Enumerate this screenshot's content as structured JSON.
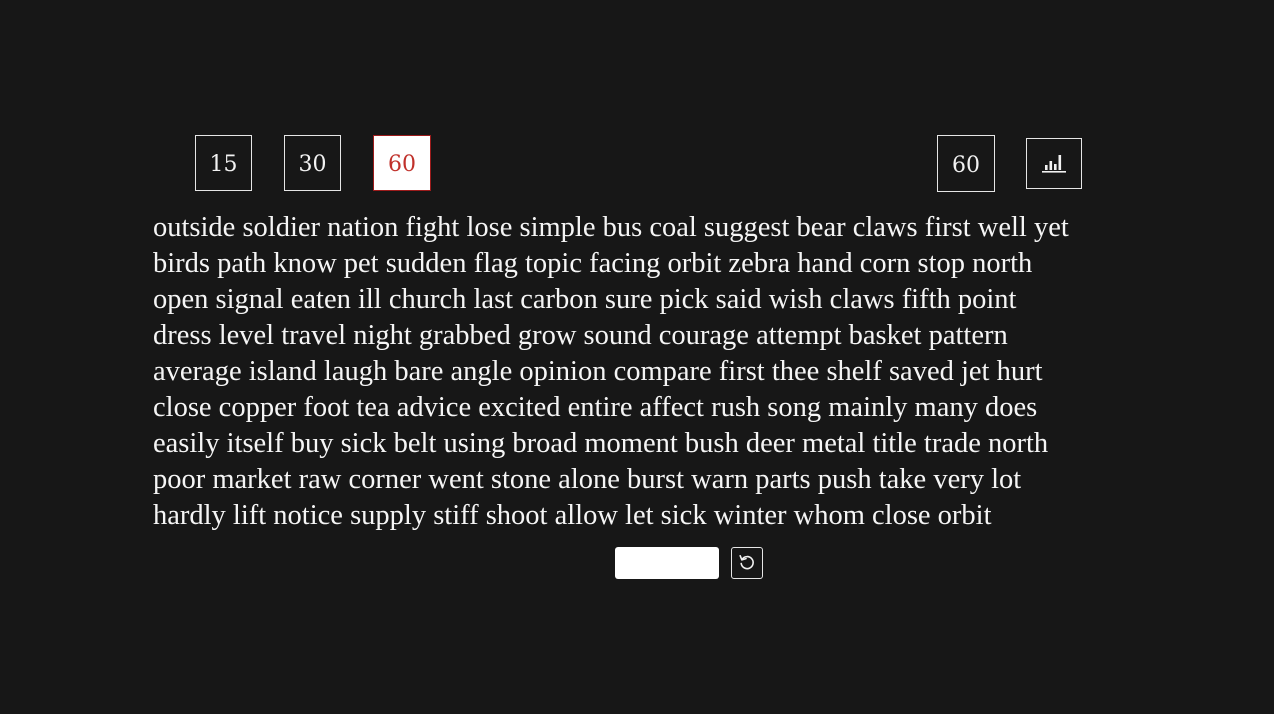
{
  "time_options": [
    {
      "label": "15",
      "selected": false
    },
    {
      "label": "30",
      "selected": false
    },
    {
      "label": "60",
      "selected": true
    }
  ],
  "timer": {
    "value": "60"
  },
  "stats_button": {
    "icon": "bar-chart-icon"
  },
  "words": {
    "lines": [
      "outside soldier nation fight lose simple bus coal suggest bear claws first well yet",
      "birds path know pet sudden flag topic facing orbit zebra hand corn stop north",
      "open signal eaten ill church last carbon sure pick said wish claws fifth point",
      "dress level travel night grabbed grow sound courage attempt basket pattern",
      "average island laugh bare angle opinion compare first thee shelf saved jet hurt",
      "close copper foot tea advice excited entire affect rush song mainly many does",
      "easily itself buy sick belt using broad moment bush deer metal title trade north",
      "poor market raw corner went stone alone burst warn parts push take very lot",
      "hardly lift notice supply stiff shoot allow let sick winter whom close orbit"
    ]
  },
  "typing_input": {
    "value": "",
    "placeholder": ""
  },
  "restart_button": {
    "icon": "restart-icon"
  },
  "colors": {
    "background": "#171717",
    "text": "#f5f5f5",
    "accent": "#c0312b",
    "border": "#e6e6e6"
  }
}
